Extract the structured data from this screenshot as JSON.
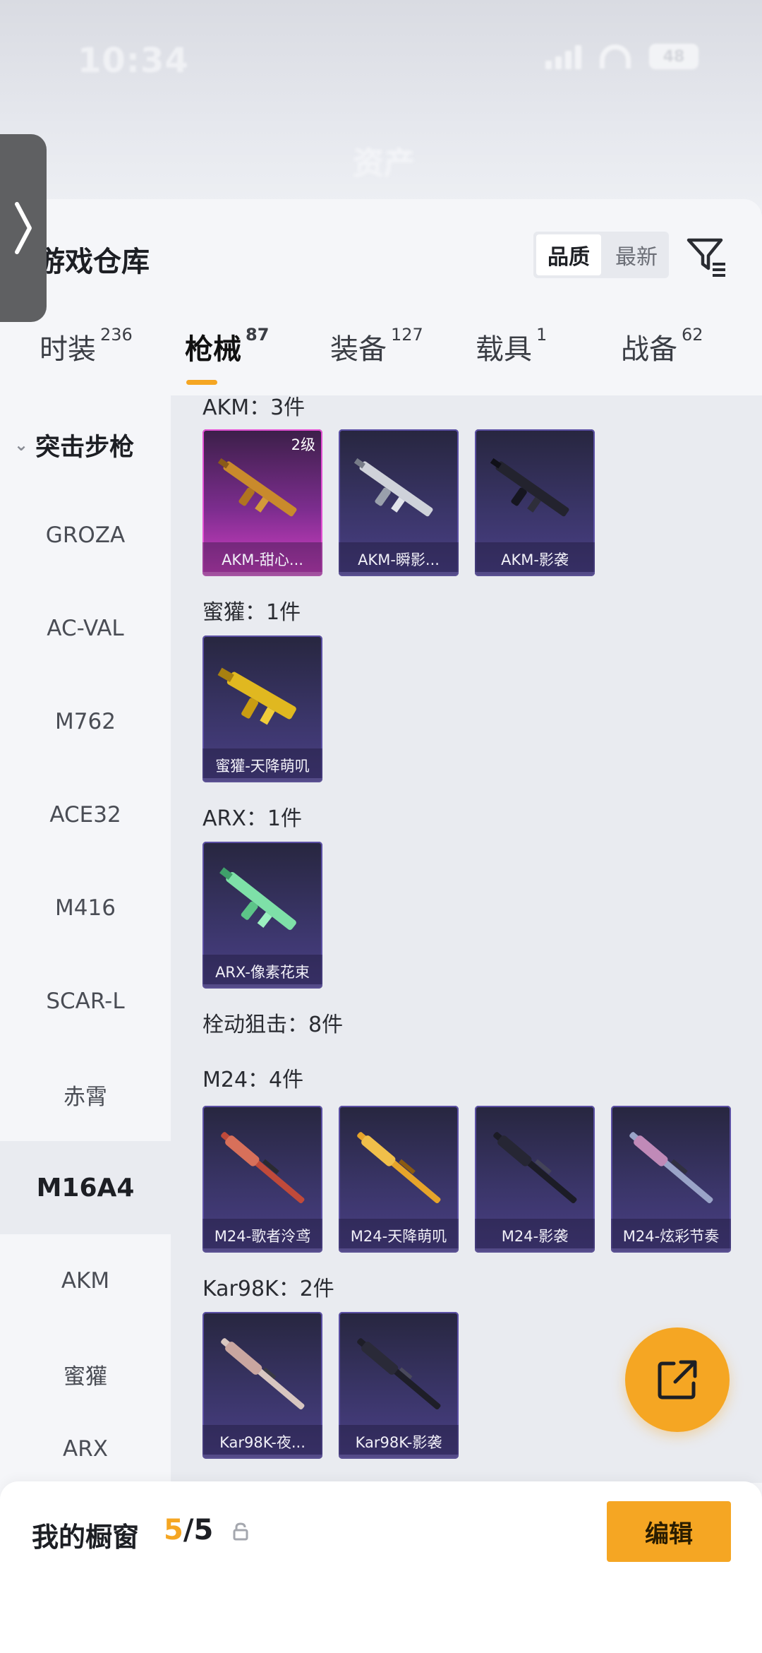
{
  "status": {
    "time": "10:34",
    "battery": "48"
  },
  "background": {
    "title": "资产"
  },
  "header": {
    "title": "游戏仓库"
  },
  "sort": {
    "options": [
      "品质",
      "最新"
    ],
    "active": "品质"
  },
  "tabs": [
    {
      "label": "时装",
      "count": "236"
    },
    {
      "label": "枪械",
      "count": "87",
      "active": true
    },
    {
      "label": "装备",
      "count": "127"
    },
    {
      "label": "载具",
      "count": "1"
    },
    {
      "label": "战备",
      "count": "62"
    }
  ],
  "categories": {
    "group_label": "突击步枪",
    "items": [
      "GROZA",
      "AC-VAL",
      "M762",
      "ACE32",
      "M416",
      "SCAR-L",
      "赤霄",
      "M16A4",
      "AKM",
      "蜜獾",
      "ARX"
    ],
    "selected": "M16A4"
  },
  "sections": {
    "akm": {
      "label": "AKM：3件",
      "items": [
        {
          "name": "AKM-甜心...",
          "level": "2级"
        },
        {
          "name": "AKM-瞬影..."
        },
        {
          "name": "AKM-影袭"
        }
      ]
    },
    "honey_badger": {
      "label": "蜜獾：1件",
      "items": [
        {
          "name": "蜜獾-天降萌叽"
        }
      ]
    },
    "arx": {
      "label": "ARX：1件",
      "items": [
        {
          "name": "ARX-像素花束"
        }
      ]
    },
    "bolt_sniper": {
      "label": "栓动狙击：8件"
    },
    "m24": {
      "label": "M24：4件",
      "items": [
        {
          "name": "M24-歌者泠鸢"
        },
        {
          "name": "M24-天降萌叽"
        },
        {
          "name": "M24-影袭"
        },
        {
          "name": "M24-炫彩节奏"
        }
      ]
    },
    "kar98k": {
      "label": "Kar98K：2件",
      "items": [
        {
          "name": "Kar98K-夜..."
        },
        {
          "name": "Kar98K-影袭"
        }
      ]
    }
  },
  "bottom": {
    "showcase_label": "我的橱窗",
    "showcase_used": "5",
    "showcase_total": "/5",
    "edit_label": "编辑"
  },
  "colors": {
    "accent": "#f5a623",
    "pink_rarity": "#d43fc4",
    "purple_rarity": "#4a3f86"
  },
  "icons": [
    "chevron-right-icon",
    "filter-icon",
    "chevron-down-icon",
    "lock-icon",
    "share-icon"
  ]
}
